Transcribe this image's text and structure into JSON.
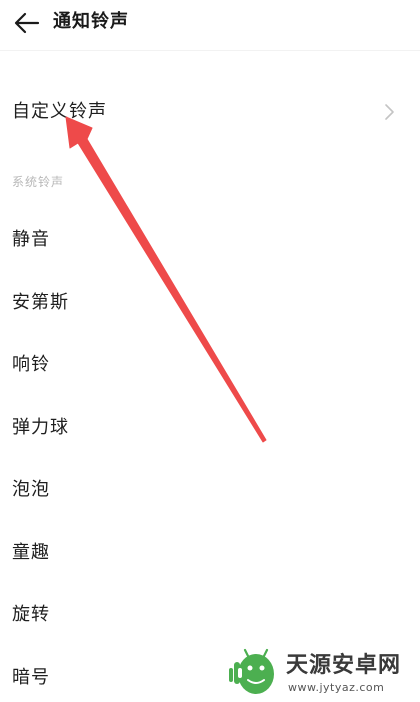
{
  "header": {
    "back_icon": "arrow-left-icon",
    "title": "通知铃声"
  },
  "custom_ringtone": {
    "label": "自定义铃声",
    "chevron_icon": "chevron-right-icon"
  },
  "system_section": {
    "label": "系统铃声",
    "items": [
      {
        "label": "静音"
      },
      {
        "label": "安第斯"
      },
      {
        "label": "响铃"
      },
      {
        "label": "弹力球"
      },
      {
        "label": "泡泡"
      },
      {
        "label": "童趣"
      },
      {
        "label": "旋转"
      },
      {
        "label": "暗号"
      }
    ]
  },
  "annotation": {
    "color": "#ee4a4a"
  },
  "watermark": {
    "title": "天源安卓网",
    "url": "www.jytyaz.com",
    "logo_color": "#4caf50"
  }
}
